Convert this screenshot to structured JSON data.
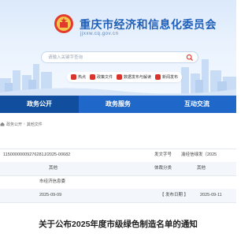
{
  "site": {
    "title": "重庆市经济和信息化委员会",
    "domain": "jjxxw.cq.gov.cn"
  },
  "search": {
    "placeholder": "请输入关键字查询"
  },
  "quick_links": [
    {
      "label": "热点",
      "icon": "hot-icon"
    },
    {
      "label": "政策文件",
      "icon": "document-icon"
    },
    {
      "label": "数据发布与解读",
      "icon": "chart-icon"
    },
    {
      "label": "新闻发布",
      "icon": "megaphone-icon"
    }
  ],
  "main_nav": {
    "tabs": [
      {
        "label": "政务公开",
        "active": true
      },
      {
        "label": "政务服务",
        "active": false
      },
      {
        "label": "互动交流",
        "active": false
      }
    ]
  },
  "breadcrumb": {
    "items": [
      "政务公开",
      "其他文件"
    ]
  },
  "meta": {
    "index_number": "11500000009276281J/2025-00682",
    "issuing_no_label": "发文字号",
    "issuing_no_value": "渝经信绿发〔2025",
    "topic_value": "其他",
    "body_label": "体裁分类",
    "body_value": "其他",
    "issuer_value": "市经济信息委",
    "date_value": "2025-09-09",
    "publish_label": "【 发布日期 】",
    "publish_value": "2025-09-11"
  },
  "document": {
    "title": "关于公布2025年度市级绿色制造名单的通知"
  },
  "colors": {
    "brand_blue": "#1f67c8",
    "active_tab": "#124e9e",
    "quick_icon_red": "#d9342b"
  }
}
